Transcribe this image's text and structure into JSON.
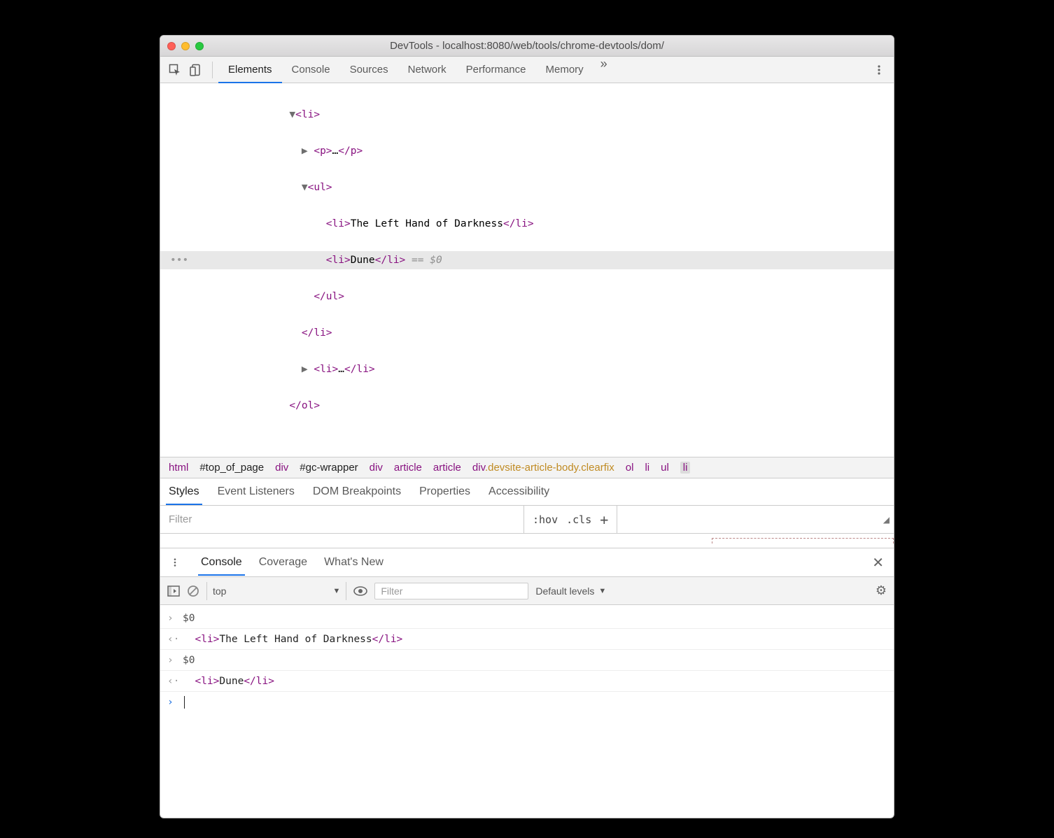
{
  "window": {
    "title": "DevTools - localhost:8080/web/tools/chrome-devtools/dom/"
  },
  "tabs": {
    "items": [
      "Elements",
      "Console",
      "Sources",
      "Network",
      "Performance",
      "Memory"
    ],
    "active": 0
  },
  "dom": {
    "l1": "<li>",
    "l2a": "<p>",
    "l2b": "…",
    "l2c": "</p>",
    "l3": "<ul>",
    "l4a": "<li>",
    "l4txt": "The Left Hand of Darkness",
    "l4c": "</li>",
    "l5a": "<li>",
    "l5txt": "Dune",
    "l5c": "</li>",
    "l5d": " == $0",
    "l6": "</ul>",
    "l7": "</li>",
    "l8a": "<li>",
    "l8b": "…",
    "l8c": "</li>",
    "l9": "</ol>",
    "gutter_sel": "•••"
  },
  "breadcrumbs": {
    "b1": "html",
    "b2": "#top_of_page",
    "b3": "div",
    "b4": "#gc-wrapper",
    "b5": "div",
    "b6": "article",
    "b7": "article",
    "b8p": "div",
    "b8c": ".devsite-article-body.clearfix",
    "b9": "ol",
    "b10": "li",
    "b11": "ul",
    "b12": "li"
  },
  "subtabs": {
    "items": [
      "Styles",
      "Event Listeners",
      "DOM Breakpoints",
      "Properties",
      "Accessibility"
    ],
    "active": 0
  },
  "styles": {
    "filter_placeholder": "Filter",
    "hov": ":hov",
    "cls": ".cls"
  },
  "drawer": {
    "tabs": [
      "Console",
      "Coverage",
      "What's New"
    ],
    "active": 0
  },
  "console_toolbar": {
    "context": "top",
    "filter_placeholder": "Filter",
    "levels": "Default levels"
  },
  "console": {
    "r1": "$0",
    "r2a": "<li>",
    "r2b": "The Left Hand of Darkness",
    "r2c": "</li>",
    "r3": "$0",
    "r4a": "<li>",
    "r4b": "Dune",
    "r4c": "</li>"
  }
}
